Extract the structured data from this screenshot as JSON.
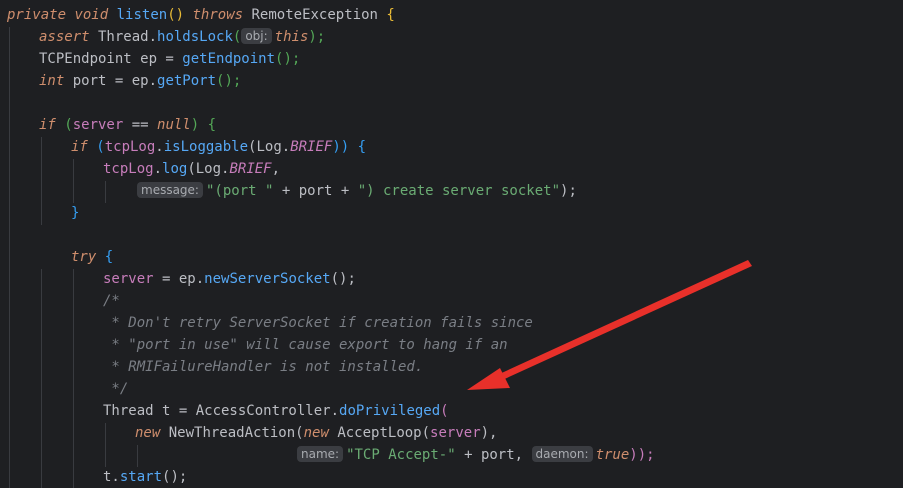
{
  "code": {
    "l1": {
      "kw1": "private",
      "kw2": "void",
      "fn": "listen",
      "paren": "()",
      "throws": "throws",
      "exc": " RemoteException ",
      "brace": "{"
    },
    "l2": {
      "assert": "assert",
      "t1": " Thread.",
      "fn": "holdsLock",
      "p1": "(",
      "hint": "obj:",
      "this": "this",
      "p2": ");"
    },
    "l3": {
      "t1": "TCPEndpoint ep = ",
      "fn": "getEndpoint",
      "p": "();"
    },
    "l4": {
      "kw": "int",
      "t1": " port = ep.",
      "fn": "getPort",
      "p": "();"
    },
    "l6": {
      "kw": "if",
      "t1": " (",
      "field": "server",
      "t2": " == ",
      "null": "null",
      "t3": ") {"
    },
    "l7": {
      "kw": "if",
      "t1": " (",
      "field": "tcpLog",
      "t2": ".",
      "fn": "isLoggable",
      "t3": "(Log.",
      "const": "BRIEF",
      "t4": ")) {"
    },
    "l8": {
      "field": "tcpLog",
      "t1": ".",
      "fn": "log",
      "t2": "(Log.",
      "const": "BRIEF",
      "t3": ","
    },
    "l9": {
      "hint": "message:",
      "str1": "\"(port \"",
      "t1": " + port + ",
      "str2": "\") create server socket\"",
      "t2": ");"
    },
    "l10": {
      "t": "}"
    },
    "l12": {
      "kw": "try",
      "t": " {"
    },
    "l13": {
      "field": "server",
      "t1": " = ep.",
      "fn": "newServerSocket",
      "t2": "();"
    },
    "c1": "/*",
    "c2": " * Don't retry ServerSocket if creation fails since",
    "c3": " * \"port in use\" will cause export to hang if an",
    "c4": " * RMIFailureHandler is not installed.",
    "c5": " */",
    "l19": {
      "t1": "Thread t = AccessController.",
      "fn": "doPrivileged",
      "t2": "("
    },
    "l20": {
      "kw1": "new",
      "t1": " NewThreadAction(",
      "kw2": "new",
      "t2": " AcceptLoop(",
      "field": "server",
      "t3": "),"
    },
    "l21": {
      "hint1": "name:",
      "str": "\"TCP Accept-\"",
      "t1": " + port, ",
      "hint2": "daemon:",
      "true": "true",
      "t2": "));"
    },
    "l22": {
      "t1": "t.",
      "fn": "start",
      "t2": "();"
    }
  },
  "colors": {
    "background": "#1e1f22",
    "keyword": "#cf8e6d",
    "method": "#56a8f5",
    "field": "#c77dbb",
    "string": "#6aab73",
    "comment": "#7a7e85",
    "annotation_arrow": "#e8302a"
  }
}
